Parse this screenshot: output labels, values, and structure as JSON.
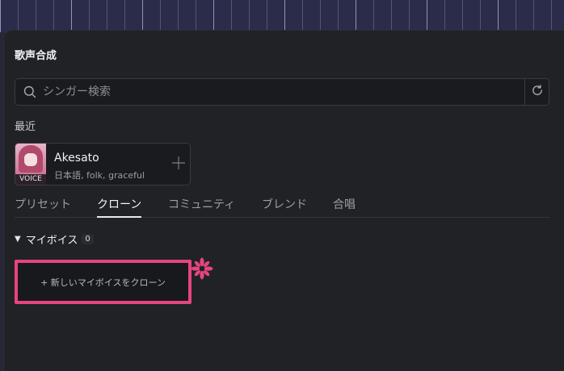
{
  "dialog": {
    "title": "歌声合成"
  },
  "search": {
    "placeholder": "シンガー検索",
    "value": ""
  },
  "recent": {
    "heading": "最近",
    "items": [
      {
        "name": "Akesato",
        "tags": "日本語, folk, graceful",
        "badge": "VOICE"
      }
    ]
  },
  "tabs": [
    {
      "label": "プリセット",
      "active": false
    },
    {
      "label": "クローン",
      "active": true
    },
    {
      "label": "コミュニティ",
      "active": false
    },
    {
      "label": "ブレンド",
      "active": false
    },
    {
      "label": "合唱",
      "active": false
    }
  ],
  "my_voices": {
    "label": "マイボイス",
    "count": "0",
    "clone_button_label": "+ 新しいマイボイスをクローン"
  },
  "colors": {
    "highlight": "#e6457f",
    "panel": "#212226",
    "background": "#2b2b48"
  },
  "icons": [
    "search-icon",
    "refresh-icon",
    "plus-icon",
    "caret-down-icon",
    "sparkle-icon"
  ]
}
